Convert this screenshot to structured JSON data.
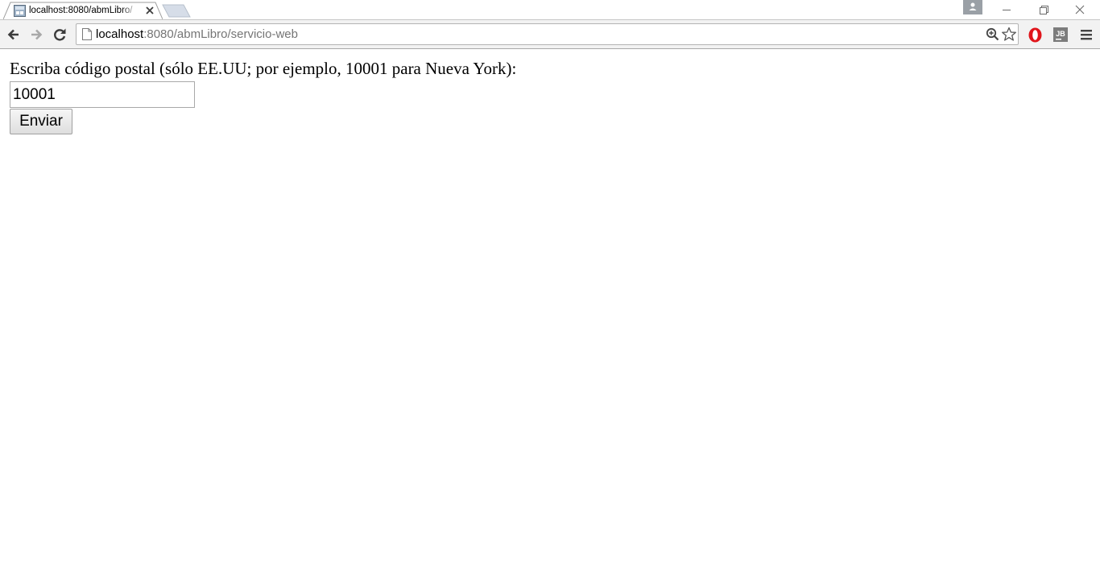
{
  "browser": {
    "tab": {
      "title": "localhost:8080/abmLibro/"
    },
    "address_bar": {
      "host": "localhost",
      "rest": ":8080/abmLibro/servicio-web"
    }
  },
  "page": {
    "prompt": "Escriba código postal (sólo EE.UU; por ejemplo, 10001 para Nueva York):",
    "zip_value": "10001",
    "submit_label": "Enviar"
  },
  "icons": {
    "favicon": "page-favicon-icon",
    "tab_close": "close-icon",
    "back": "arrow-left-icon",
    "forward": "arrow-right-icon",
    "reload": "reload-icon",
    "page": "document-icon",
    "zoom": "zoom-icon",
    "bookmark": "star-icon",
    "opera_extension": "opera-icon",
    "jb_extension": "jetbrains-icon",
    "menu": "hamburger-menu-icon",
    "profile": "person-icon"
  },
  "colors": {
    "toolbar": "#f2f2f2",
    "url_rest": "#757575",
    "opera_red": "#e0151b"
  }
}
